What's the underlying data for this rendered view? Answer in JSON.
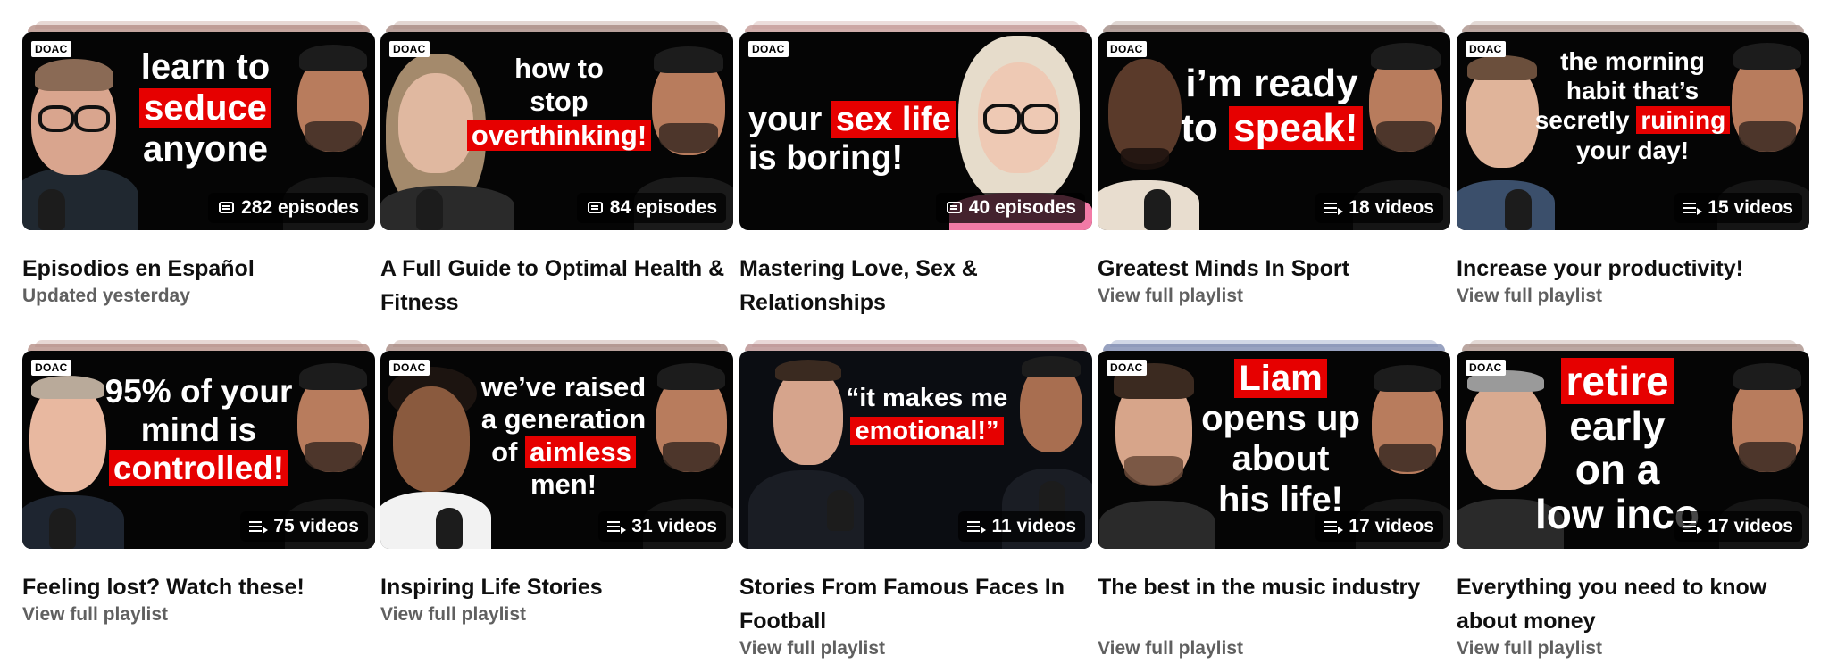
{
  "brand_label": "DOAC",
  "colors": {
    "accent_red": "#e60000",
    "title_text": "#0f0f0f",
    "sub_text": "#606060"
  },
  "playlists": [
    {
      "title": "Episodios en Español",
      "subtitle": "Updated yesterday",
      "count_label": "282 episodes",
      "count_icon": "podcast-icon",
      "thumb_text": {
        "line1": "learn to",
        "line2": "seduce",
        "line3": "anyone"
      }
    },
    {
      "title": "A Full Guide to Optimal Health & Fitness",
      "subtitle": "",
      "count_label": "84 episodes",
      "count_icon": "podcast-icon",
      "thumb_text": {
        "line1": "how to",
        "line2": "stop",
        "line3": "overthinking!"
      }
    },
    {
      "title": "Mastering Love, Sex & Relationships",
      "subtitle": "",
      "count_label": "40 episodes",
      "count_icon": "podcast-icon",
      "thumb_text": {
        "line1a": "your",
        "line1b": "sex life",
        "line2": "is boring!"
      }
    },
    {
      "title": "Greatest Minds In Sport",
      "subtitle": "View full playlist",
      "count_label": "18 videos",
      "count_icon": "playlist-icon",
      "thumb_text": {
        "line1": "i’m ready",
        "line2a": "to",
        "line2b": "speak!"
      }
    },
    {
      "title": "Increase your productivity!",
      "subtitle": "View full playlist",
      "count_label": "15 videos",
      "count_icon": "playlist-icon",
      "thumb_text": {
        "line1": "the morning",
        "line2": "habit that’s",
        "line3a": "secretly",
        "line3b": "ruining",
        "line4": "your day!"
      }
    },
    {
      "title": "Feeling lost? Watch these!",
      "subtitle": "View full playlist",
      "count_label": "75 videos",
      "count_icon": "playlist-icon",
      "thumb_text": {
        "line1": "95% of your",
        "line2": "mind is",
        "line3": "controlled!"
      }
    },
    {
      "title": "Inspiring Life Stories",
      "subtitle": "View full playlist",
      "count_label": "31 videos",
      "count_icon": "playlist-icon",
      "thumb_text": {
        "line1": "we’ve raised",
        "line2": "a generation",
        "line3a": "of",
        "line3b": "aimless",
        "line4": "men!"
      }
    },
    {
      "title": "Stories From Famous Faces In Football",
      "subtitle": "View full playlist",
      "count_label": "11 videos",
      "count_icon": "playlist-icon",
      "thumb_text": {
        "line1": "“it makes me",
        "line2": "emotional!”"
      }
    },
    {
      "title": "The best in the music industry",
      "subtitle": "View full playlist",
      "count_label": "17 videos",
      "count_icon": "playlist-icon",
      "thumb_text": {
        "line1": "Liam",
        "line2": "opens up",
        "line3": "about",
        "line4": "his life!"
      }
    },
    {
      "title": "Everything you need to know about money",
      "subtitle": "View full playlist",
      "count_label": "17 videos",
      "count_icon": "playlist-icon",
      "thumb_text": {
        "line1": "retire",
        "line2": "early",
        "line3": "on a",
        "line4": "low inco"
      }
    }
  ]
}
